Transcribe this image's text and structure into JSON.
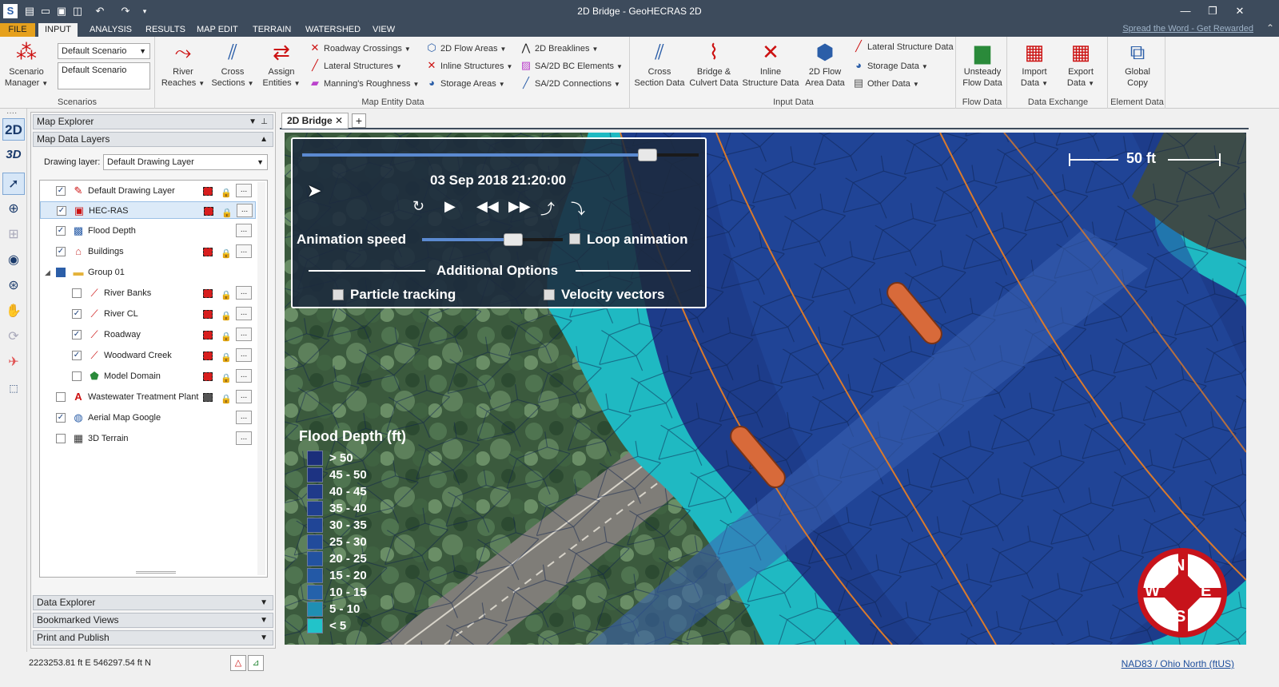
{
  "window": {
    "title": "2D Bridge - GeoHECRAS 2D"
  },
  "tabs": [
    {
      "label": "FILE"
    },
    {
      "label": "INPUT"
    },
    {
      "label": "ANALYSIS"
    },
    {
      "label": "RESULTS"
    },
    {
      "label": "MAP EDIT"
    },
    {
      "label": "TERRAIN"
    },
    {
      "label": "WATERSHED"
    },
    {
      "label": "VIEW"
    }
  ],
  "promo": "Spread the Word - Get Rewarded",
  "ribbon": {
    "scenarios": {
      "manager_label": "Scenario Manager",
      "combo_value": "Default Scenario",
      "list_value": "Default Scenario",
      "group_label": "Scenarios"
    },
    "map_entity": {
      "big": [
        "River Reaches",
        "Cross Sections",
        "Assign Entities"
      ],
      "small": [
        "Roadway Crossings",
        "Lateral Structures",
        "Manning's Roughness",
        "2D Flow Areas",
        "Inline Structures",
        "Storage Areas",
        "2D Breaklines",
        "SA/2D BC Elements",
        "SA/2D Connections"
      ],
      "group_label": "Map Entity Data"
    },
    "input": {
      "big": [
        "Cross Section Data",
        "Bridge & Culvert Data",
        "Inline Structure Data",
        "2D Flow Area Data"
      ],
      "small": [
        "Lateral Structure Data",
        "Storage Data",
        "Other Data"
      ],
      "group_label": "Input Data"
    },
    "flow": {
      "big": "Unsteady Flow Data",
      "group_label": "Flow Data"
    },
    "exchange": {
      "big": [
        "Import Data",
        "Export Data"
      ],
      "group_label": "Data Exchange"
    },
    "element": {
      "big": "Global Copy",
      "group_label": "Element Data"
    }
  },
  "left_tools": [
    "2D",
    "3D"
  ],
  "panel": {
    "title": "Map Explorer",
    "section": "Map Data Layers",
    "drawing_layer_label": "Drawing layer:",
    "drawing_layer_value": "Default Drawing Layer",
    "layers": [
      {
        "name": "Default Drawing Layer",
        "checked": true
      },
      {
        "name": "HEC-RAS",
        "checked": true
      },
      {
        "name": "Flood Depth",
        "checked": true
      },
      {
        "name": "Buildings",
        "checked": true
      },
      {
        "name": "Group 01",
        "checked": true
      },
      {
        "name": "River Banks",
        "checked": false
      },
      {
        "name": "River CL",
        "checked": true
      },
      {
        "name": "Roadway",
        "checked": true
      },
      {
        "name": "Woodward Creek",
        "checked": true
      },
      {
        "name": "Model Domain",
        "checked": false
      },
      {
        "name": "Wastewater Treatment Plant",
        "checked": false
      },
      {
        "name": "Aerial Map Google",
        "checked": true
      },
      {
        "name": "3D Terrain",
        "checked": false
      }
    ],
    "bottom_sections": [
      "Data Explorer",
      "Bookmarked Views",
      "Print and Publish"
    ]
  },
  "document_tab": "2D Bridge",
  "animation": {
    "timestamp": "03 Sep 2018 21:20:00",
    "time_progress": 0.87,
    "speed_label": "Animation speed",
    "speed_level": 0.65,
    "loop_label": "Loop animation",
    "options_label": "Additional Options",
    "particle_label": "Particle tracking",
    "velocity_label": "Velocity vectors"
  },
  "legend": {
    "title": "Flood Depth (ft)",
    "items": [
      {
        "label": "> 50",
        "color": "#1b2e7a"
      },
      {
        "label": "45 - 50",
        "color": "#1d3382"
      },
      {
        "label": "40 - 45",
        "color": "#1f3a8a"
      },
      {
        "label": "35 - 40",
        "color": "#1f3f90"
      },
      {
        "label": "30 - 35",
        "color": "#204596"
      },
      {
        "label": "25 - 30",
        "color": "#214b9b"
      },
      {
        "label": "20 - 25",
        "color": "#2252a0"
      },
      {
        "label": "15 - 20",
        "color": "#2359a6"
      },
      {
        "label": "10 - 15",
        "color": "#2462ab"
      },
      {
        "label": "5 - 10",
        "color": "#1f8fb3"
      },
      {
        "label": "< 5",
        "color": "#22c3c9"
      }
    ]
  },
  "scale_text": "50 ft",
  "compass": {
    "n": "N",
    "s": "S",
    "e": "E",
    "w": "W"
  },
  "status": {
    "coords": "2223253.81 ft E  546297.54 ft N",
    "projection": "NAD83 / Ohio North (ftUS)"
  }
}
